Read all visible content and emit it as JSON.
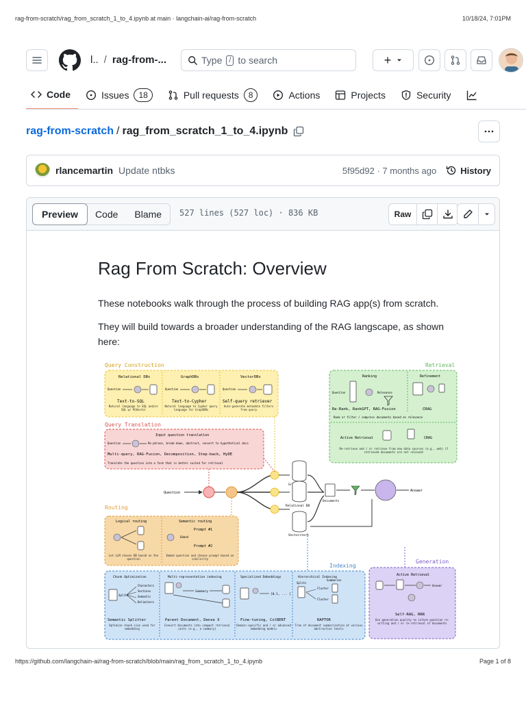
{
  "print": {
    "title": "rag-from-scratch/rag_from_scratch_1_to_4.ipynb at main · langchain-ai/rag-from-scratch",
    "datetime": "10/18/24, 7:01PM",
    "url": "https://github.com/langchain-ai/rag-from-scratch/blob/main/rag_from_scratch_1_to_4.ipynb",
    "page": "Page 1 of 8"
  },
  "header": {
    "owner": "l..",
    "separator": "/",
    "repo": "rag-from-...",
    "search_prefix": "Type",
    "search_key": "/",
    "search_suffix": "to search",
    "plus": "+"
  },
  "tabs": [
    {
      "label": "Code",
      "icon": "code-icon",
      "count": null,
      "active": true
    },
    {
      "label": "Issues",
      "icon": "issue-icon",
      "count": "18",
      "active": false
    },
    {
      "label": "Pull requests",
      "icon": "pull-request-icon",
      "count": "8",
      "active": false
    },
    {
      "label": "Actions",
      "icon": "play-icon",
      "count": null,
      "active": false
    },
    {
      "label": "Projects",
      "icon": "table-icon",
      "count": null,
      "active": false
    },
    {
      "label": "Security",
      "icon": "shield-icon",
      "count": null,
      "active": false
    }
  ],
  "path": {
    "repo_link": "rag-from-scratch",
    "sep": "/",
    "file": "rag_from_scratch_1_to_4.ipynb"
  },
  "commit": {
    "author": "rlancemartin",
    "message": "Update ntbks",
    "sha_age": "5f95d92 · 7 months ago",
    "history": "History"
  },
  "file": {
    "views": [
      "Preview",
      "Code",
      "Blame"
    ],
    "loc": "527 lines (527 loc) · 836 KB",
    "raw": "Raw"
  },
  "notebook": {
    "title": "Rag From Scratch: Overview",
    "p1": "These notebooks walk through the process of building RAG app(s) from scratch.",
    "p2": "They will build towards a broader understanding of the RAG langscape, as shown here:"
  },
  "diagram": {
    "query_construction": "Query Construction",
    "relational_dbs": "Relational DBs",
    "graph_dbs": "GraphDBs",
    "vector_dbs": "VectorDBs",
    "text_to_sql": "Text-to-SQL",
    "text_to_cypher": "Text-to-Cypher",
    "self_query": "Self-query retriever",
    "sql_desc": "Natural language to SQL and/or SQL w/ PGVector",
    "cypher_desc": "Natural language to Cypher query language for GraphDBs",
    "selfq_desc": "Auto-generate metadata filters from query",
    "question": "Question",
    "query_translation": "Query Translation",
    "input_translation": "Input question translation",
    "qt_flow": "Re-phrase, break-down, abstract, convert to hypothetical docs",
    "qt_methods": "Multi-query, RAG-Fusion, Decomposition, Step-back, HyDE",
    "qt_desc": "Translate the question into a form that is better suited for retrieval",
    "routing": "Routing",
    "logical_routing": "Logical routing",
    "semantic_routing": "Semantic routing",
    "prompt1": "Prompt #1",
    "prompt2": "Prompt #2",
    "embed": "Embed",
    "routing_left": "Let LLM choose DB based on the question",
    "routing_right": "Embed question and choose prompt based on similarity",
    "graph_db": "Graph DB",
    "relational_db": "Relational DB",
    "vectorstore": "Vectorstore",
    "documents": "Documents",
    "answer": "Answer",
    "retrieval": "Retrieval",
    "ranking": "Ranking",
    "refinement": "Refinement",
    "relevance": "Relevance",
    "rerank": "Re-Rank, RankGPT, RAG-Fusion",
    "crag": "CRAG",
    "retrieval_desc": "Rank or filter / compress documents based on relevance",
    "active_retrieval": "Active Retrieval",
    "active_desc": "Re-retrieve and / or retrieve from new data sources (e.g., web) if retrieved documents are not relevant",
    "indexing": "Indexing",
    "chunk_opt": "Chunk Optimization",
    "multi_rep": "Multi-representation indexing",
    "spec_emb": "Specialized Embeddings",
    "hier_idx": "Hierarchical Indexing",
    "characters": "Characters",
    "sections": "Sections",
    "semantic": "Semantic",
    "delimiters": "Delimiters",
    "splits": "Splits",
    "summary": "Summary",
    "summaries": "Summaries",
    "cluster": "Cluster",
    "vector_txt": "[0.1, ... ]",
    "semantic_splitter": "Semantic Splitter",
    "parent_doc": "Parent Document, Dense X",
    "finetune": "Fine-tuning, ColBERT",
    "raptor": "RAPTOR",
    "chunk_desc": "Optimize chunk size used for embedding",
    "multi_desc": "Convert documents into compact retrieval units (e.g., a summary)",
    "spec_desc": "Domain-specific and / or advanced embedding models",
    "hier_desc": "Tree of document summarization at various abstraction levels",
    "generation": "Generation",
    "self_rag": "Self-RAG, RRR",
    "gen_desc": "Use generation quality to inform question re-writing and / or re-retrieval of documents"
  },
  "colors": {
    "yellow_bg": "#fdf0b0",
    "yellow_bd": "#e8c33c",
    "red_bg": "#f9d6d6",
    "red_bd": "#d9534f",
    "orange_bg": "#f7d9a8",
    "orange_bd": "#e09a3a",
    "green_bg": "#d4f0cf",
    "green_bd": "#5cb85c",
    "blue_bg": "#cfe3f7",
    "blue_bd": "#3f83c9",
    "purple_bg": "#dcd2f5",
    "purple_bd": "#7a5ac8",
    "link": "#0969da",
    "tab_underline": "#fd8c73"
  }
}
